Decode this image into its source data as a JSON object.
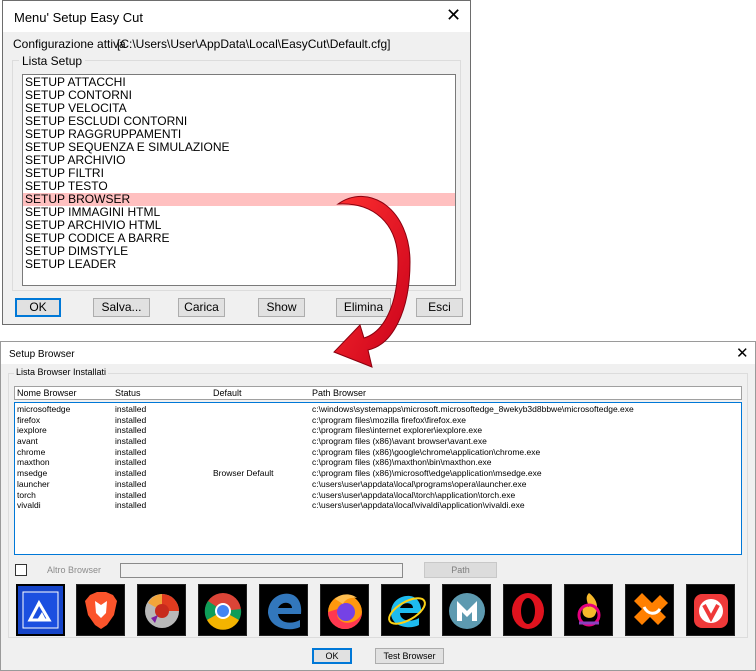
{
  "window1": {
    "title": "Menu' Setup Easy Cut",
    "config_label": "Configurazione attiva",
    "config_value": "[C:\\Users\\User\\AppData\\Local\\EasyCut\\Default.cfg]",
    "group_label": "Lista Setup",
    "items": [
      "SETUP ATTACCHI",
      "SETUP CONTORNI",
      "SETUP VELOCITA",
      "SETUP ESCLUDI CONTORNI",
      "SETUP RAGGRUPPAMENTI",
      "SETUP SEQUENZA E SIMULAZIONE",
      "SETUP ARCHIVIO",
      "SETUP FILTRI",
      "SETUP TESTO",
      "SETUP BROWSER",
      "SETUP IMMAGINI HTML",
      "SETUP ARCHIVIO HTML",
      "SETUP CODICE A BARRE",
      "SETUP DIMSTYLE",
      "SETUP LEADER"
    ],
    "selected_index": 9,
    "buttons": {
      "ok": "OK",
      "salva": "Salva...",
      "carica": "Carica",
      "show": "Show",
      "elimina": "Elimina",
      "esci": "Esci"
    }
  },
  "window2": {
    "title": "Setup Browser",
    "group_label": "Lista Browser Installati",
    "columns": [
      "Nome Browser",
      "Status",
      "Default",
      "Path Browser"
    ],
    "rows": [
      {
        "name": "microsoftedge",
        "status": "installed",
        "default": "",
        "path": "c:\\windows\\systemapps\\microsoft.microsoftedge_8wekyb3d8bbwe\\microsoftedge.exe"
      },
      {
        "name": "firefox",
        "status": "installed",
        "default": "",
        "path": "c:\\program files\\mozilla firefox\\firefox.exe"
      },
      {
        "name": "iexplore",
        "status": "installed",
        "default": "",
        "path": "c:\\program files\\internet explorer\\iexplore.exe"
      },
      {
        "name": "avant",
        "status": "installed",
        "default": "",
        "path": "c:\\program files (x86)\\avant browser\\avant.exe"
      },
      {
        "name": "chrome",
        "status": "installed",
        "default": "",
        "path": "c:\\program files (x86)\\google\\chrome\\application\\chrome.exe"
      },
      {
        "name": "maxthon",
        "status": "installed",
        "default": "",
        "path": "c:\\program files (x86)\\maxthon\\bin\\maxthon.exe"
      },
      {
        "name": "msedge",
        "status": "installed",
        "default": "Browser Default",
        "path": "c:\\program files (x86)\\microsoft\\edge\\application\\msedge.exe"
      },
      {
        "name": "launcher",
        "status": "installed",
        "default": "",
        "path": "c:\\users\\user\\appdata\\local\\programs\\opera\\launcher.exe"
      },
      {
        "name": "torch",
        "status": "installed",
        "default": "",
        "path": "c:\\users\\user\\appdata\\local\\torch\\application\\torch.exe"
      },
      {
        "name": "vivaldi",
        "status": "installed",
        "default": "",
        "path": "c:\\users\\user\\appdata\\local\\vivaldi\\application\\vivaldi.exe"
      }
    ],
    "altro_label": "Altro Browser",
    "altro_value": "",
    "path_button": "Path",
    "icons": [
      "avant-icon",
      "brave-icon",
      "epic-icon",
      "chrome-icon",
      "edge-legacy-icon",
      "firefox-icon",
      "internet-explorer-icon",
      "maxthon-icon",
      "opera-icon",
      "torch-icon",
      "uc-browser-icon",
      "vivaldi-icon"
    ],
    "ok_button": "OK",
    "test_button": "Test Browser"
  },
  "colors": {
    "selection": "#ffc0c0",
    "arrow": "#e0001a",
    "focus_border": "#0078d7"
  }
}
